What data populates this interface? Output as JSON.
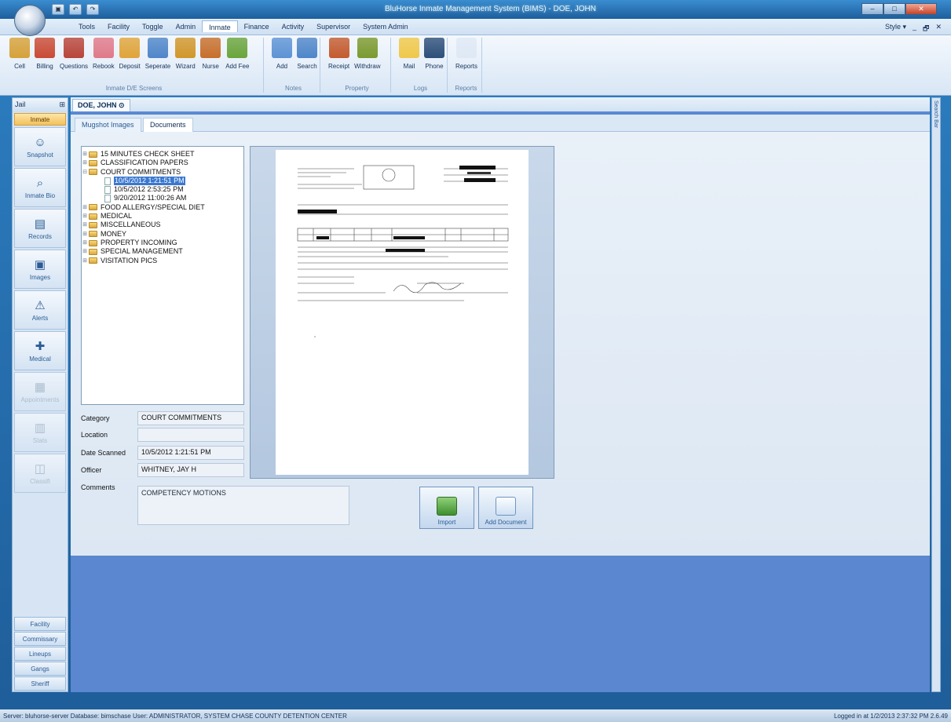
{
  "window": {
    "title": "BluHorse Inmate Management System (BIMS) - DOE, JOHN"
  },
  "quick_access": [
    "save",
    "undo",
    "redo"
  ],
  "menus": [
    "Tools",
    "Facility",
    "Toggle",
    "Admin",
    "Inmate",
    "Finance",
    "Activity",
    "Supervisor",
    "System Admin"
  ],
  "menus_active": "Inmate",
  "style_menu": "Style ▾",
  "ribbon": {
    "groups": [
      {
        "caption": "Inmate D/E Screens",
        "buttons": [
          "Cell",
          "Billing",
          "Questions",
          "Rebook",
          "Deposit",
          "Seperate",
          "Wizard",
          "Nurse",
          "Add Fee"
        ]
      },
      {
        "caption": "Notes",
        "buttons": [
          "Add",
          "Search"
        ]
      },
      {
        "caption": "Property",
        "buttons": [
          "Receipt",
          "Withdraw"
        ]
      },
      {
        "caption": "Logs",
        "buttons": [
          "Mail",
          "Phone"
        ]
      },
      {
        "caption": "Reports",
        "buttons": [
          "Reports"
        ]
      }
    ]
  },
  "sidebar": {
    "header": "Jail",
    "tab": "Inmate",
    "items": [
      {
        "label": "Snapshot",
        "icon": "person-icon"
      },
      {
        "label": "Inmate Bio",
        "icon": "magnifier-icon"
      },
      {
        "label": "Records",
        "icon": "records-icon"
      },
      {
        "label": "Images",
        "icon": "images-icon"
      },
      {
        "label": "Alerts",
        "icon": "alert-icon"
      },
      {
        "label": "Medical",
        "icon": "medical-icon"
      },
      {
        "label": "Appointments",
        "icon": "calendar-icon"
      },
      {
        "label": "Stats",
        "icon": "stats-icon"
      },
      {
        "label": "Classifi",
        "icon": "classify-icon"
      }
    ],
    "footer": [
      "Facility",
      "Commissary",
      "Lineups",
      "Gangs",
      "Sheriff"
    ]
  },
  "doc_tab": "DOE, JOHN",
  "subtabs": [
    "Mugshot Images",
    "Documents"
  ],
  "tree": [
    {
      "label": "15 MINUTES CHECK SHEET",
      "type": "folder"
    },
    {
      "label": "CLASSIFICATION PAPERS",
      "type": "folder"
    },
    {
      "label": "COURT COMMITMENTS",
      "type": "folder",
      "expanded": true
    },
    {
      "label": "10/5/2012 1:21:51 PM",
      "type": "doc",
      "selected": true
    },
    {
      "label": "10/5/2012 2:53:25 PM",
      "type": "doc"
    },
    {
      "label": "9/20/2012 11:00:26 AM",
      "type": "doc"
    },
    {
      "label": "FOOD ALLERGY/SPECIAL DIET",
      "type": "folder"
    },
    {
      "label": "MEDICAL",
      "type": "folder"
    },
    {
      "label": "MISCELLANEOUS",
      "type": "folder"
    },
    {
      "label": "MONEY",
      "type": "folder"
    },
    {
      "label": "PROPERTY INCOMING",
      "type": "folder"
    },
    {
      "label": "SPECIAL MANAGEMENT",
      "type": "folder"
    },
    {
      "label": "VISITATION PICS",
      "type": "folder"
    }
  ],
  "fields": {
    "category": {
      "label": "Category",
      "value": "COURT COMMITMENTS"
    },
    "location": {
      "label": "Location",
      "value": ""
    },
    "date_scanned": {
      "label": "Date Scanned",
      "value": "10/5/2012 1:21:51 PM"
    },
    "officer": {
      "label": "Officer",
      "value": "WHITNEY, JAY H"
    },
    "comments": {
      "label": "Comments",
      "value": "COMPETENCY MOTIONS"
    }
  },
  "buttons": {
    "import": "Import",
    "add_document": "Add Document"
  },
  "right_bar": "Search Bar",
  "status": {
    "left": "Server: bluhorse-server  Database: bimschase  User: ADMINISTRATOR, SYSTEM    CHASE COUNTY DETENTION CENTER",
    "right": "Logged in at 1/2/2013 2:37:32 PM    2.6.49"
  }
}
